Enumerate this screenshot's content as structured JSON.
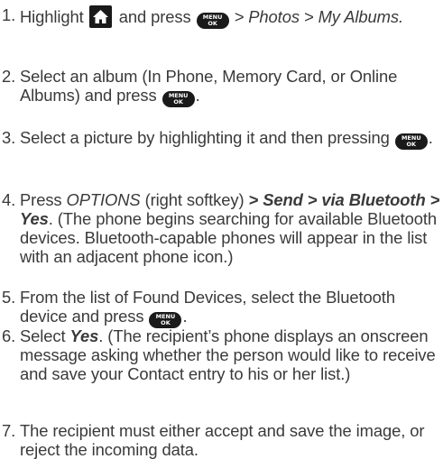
{
  "keys": {
    "menu_top": "MENU",
    "menu_bottom": "OK",
    "home_icon": "home-icon"
  },
  "steps": [
    {
      "num": "1.",
      "a": "Highlight",
      "b": "and press",
      "c": "> Photos > My Albums."
    },
    {
      "num": "2.",
      "a": "Select an album (In Phone, Memory Card, or Online Albums) and press",
      "b": "."
    },
    {
      "num": "3.",
      "a": "Select a picture by highlighting it and then pressing",
      "b": "."
    },
    {
      "num": "4.",
      "a": "Press",
      "b": "OPTIONS",
      "c": "(right softkey)",
      "d": "> Send > via Bluetooth > Yes",
      "e": ". (The phone begins searching for available Bluetooth devices. Bluetooth-capable phones will appear in the list with an adjacent phone icon.)"
    },
    {
      "num": "5.",
      "a": "From the list of Found Devices, select the Bluetooth device and press",
      "b": "."
    },
    {
      "num": "6.",
      "a": "Select",
      "b": "Yes",
      "c": ". (The recipient’s phone displays an onscreen message asking whether the person would like to receive and save your Contact entry to his or her list.)"
    },
    {
      "num": "7.",
      "a": "The recipient must either accept and save the image, or reject the incoming data."
    }
  ]
}
